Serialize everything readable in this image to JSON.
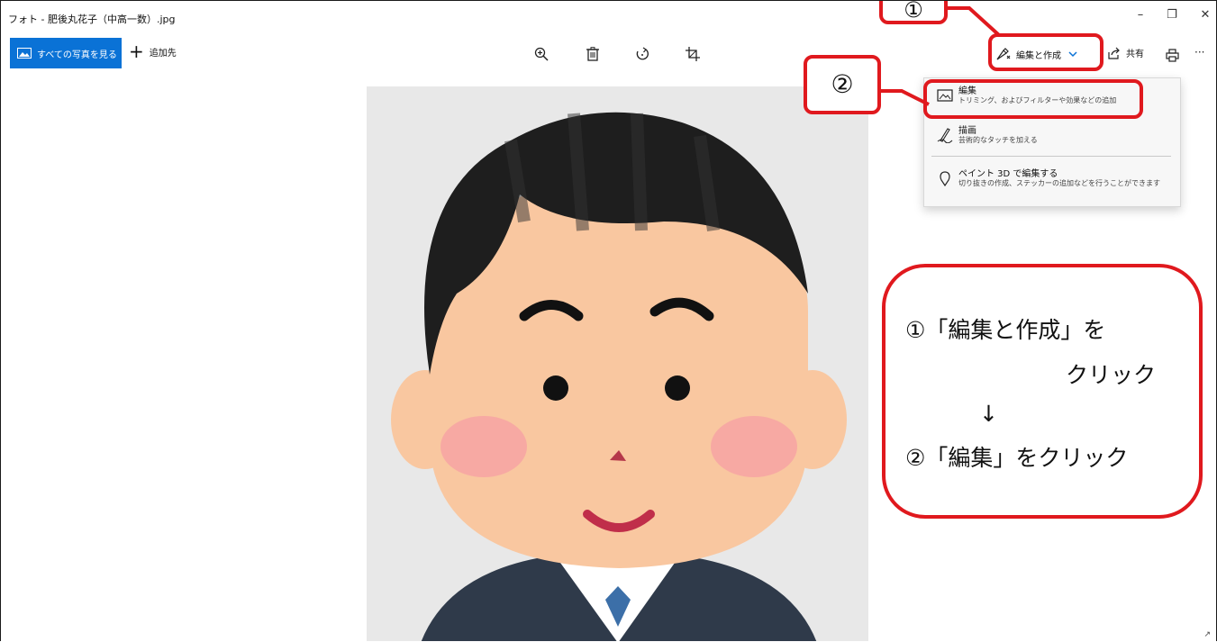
{
  "window": {
    "title": "フォト - 肥後丸花子（中高一数）.jpg",
    "minimize_glyph": "–",
    "restore_glyph": "❐",
    "close_glyph": "✕"
  },
  "toolbar": {
    "see_all_label": "すべての写真を見る",
    "add_label": "追加先",
    "edit_create_label": "編集と作成",
    "share_label": "共有",
    "more_glyph": "···",
    "icons": [
      "zoom-in-icon",
      "delete-icon",
      "rotate-icon",
      "crop-icon",
      "edit-create-icon",
      "chevron-down-icon",
      "share-icon",
      "print-icon",
      "more-icon"
    ]
  },
  "menu": {
    "items": [
      {
        "title": "編集",
        "desc": "トリミング、およびフィルターや効果などの追加",
        "icon": "image-edit-icon"
      },
      {
        "title": "描画",
        "desc": "芸術的なタッチを加える",
        "icon": "pen-draw-icon"
      },
      {
        "title": "ペイント 3D で編集する",
        "desc": "切り抜きの作成、ステッカーの追加などを行うことができます",
        "icon": "paint3d-icon"
      }
    ]
  },
  "annotations": {
    "step1_marker": "①",
    "step2_marker": "②",
    "note_line1": "①「編集と作成」を",
    "note_line2": "クリック",
    "note_arrow": "↓",
    "note_line3": "②「編集」をクリック"
  },
  "colors": {
    "accent": "#0a72d6",
    "annotation_red": "#e0191e",
    "menu_bg": "#f7f7f7"
  }
}
